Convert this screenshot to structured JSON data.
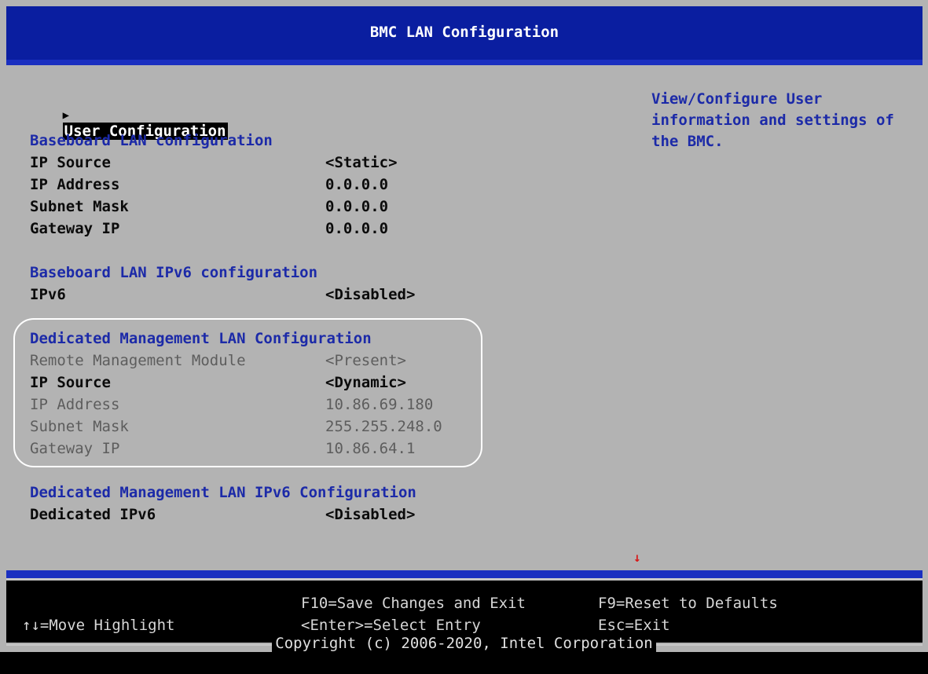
{
  "window": {
    "title": "BMC LAN Configuration"
  },
  "menu": {
    "selected_item": "User Configuration",
    "sections": [
      {
        "heading": "Baseboard LAN configuration",
        "rows": [
          {
            "label": "IP Source",
            "value": "<Static>",
            "enabled": true
          },
          {
            "label": "IP Address",
            "value": "0.0.0.0",
            "enabled": true
          },
          {
            "label": "Subnet Mask",
            "value": "0.0.0.0",
            "enabled": true
          },
          {
            "label": "Gateway IP",
            "value": "0.0.0.0",
            "enabled": true
          }
        ]
      },
      {
        "heading": "Baseboard LAN IPv6 configuration",
        "rows": [
          {
            "label": "IPv6",
            "value": "<Disabled>",
            "enabled": true
          }
        ]
      },
      {
        "heading": "Dedicated Management LAN Configuration",
        "rows": [
          {
            "label": "Remote Management Module",
            "value": "<Present>",
            "enabled": false
          },
          {
            "label": "IP Source",
            "value": "<Dynamic>",
            "enabled": true
          },
          {
            "label": "IP Address",
            "value": "10.86.69.180",
            "enabled": false
          },
          {
            "label": "Subnet Mask",
            "value": "255.255.248.0",
            "enabled": false
          },
          {
            "label": "Gateway IP",
            "value": "10.86.64.1",
            "enabled": false
          }
        ]
      },
      {
        "heading": "Dedicated Management LAN IPv6 Configuration",
        "rows": [
          {
            "label": "Dedicated IPv6",
            "value": "<Disabled>",
            "enabled": true
          }
        ]
      }
    ]
  },
  "help": {
    "text_line1": "View/Configure User",
    "text_line2": "information and settings of",
    "text_line3": "the BMC."
  },
  "footer": {
    "move_highlight": "↑↓=Move Highlight",
    "save_exit": "F10=Save Changes and Exit",
    "select_entry": "<Enter>=Select Entry",
    "reset_defaults": "F9=Reset to Defaults",
    "esc_exit": "Esc=Exit",
    "copyright": "Copyright (c) 2006-2020, Intel Corporation"
  },
  "colors": {
    "title_bar": "#0a1ea0",
    "background": "#b3b3b3",
    "section_heading": "#1c2aa8",
    "disabled_text": "#5d5d5d",
    "scroll_indicator": "#d61a1a"
  },
  "icons": {
    "selection_pointer": "triangle-right-icon",
    "scroll_down": "arrow-down-icon"
  }
}
